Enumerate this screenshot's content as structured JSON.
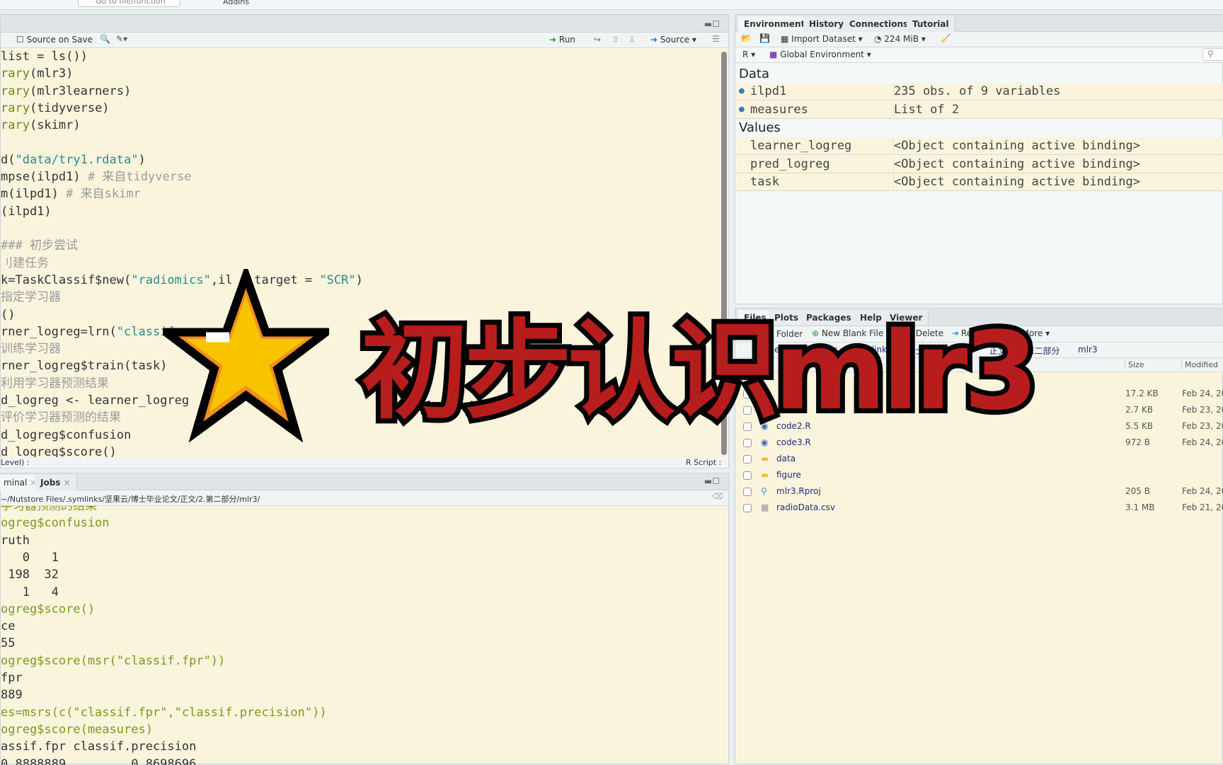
{
  "topbar": {
    "goto_placeholder": "Go to file/function",
    "addins": "Addins"
  },
  "editor": {
    "source_on_save": "Source on Save",
    "run": "Run",
    "source": "Source",
    "lines": [
      [
        [
          "list = ls())",
          ""
        ]
      ],
      [
        [
          "rary",
          "fn"
        ],
        [
          "(mlr3)",
          ""
        ]
      ],
      [
        [
          "rary",
          "fn"
        ],
        [
          "(mlr3learners)",
          ""
        ]
      ],
      [
        [
          "rary",
          "fn"
        ],
        [
          "(tidyverse)",
          ""
        ]
      ],
      [
        [
          "rary",
          "fn"
        ],
        [
          "(skimr)",
          ""
        ]
      ],
      [],
      [
        [
          "d(",
          ""
        ],
        [
          "\"data/try1.rdata\"",
          "str"
        ],
        [
          ")",
          ""
        ]
      ],
      [
        [
          "mpse(ilpd1) ",
          ""
        ],
        [
          "# 来自tidyverse",
          "cm"
        ]
      ],
      [
        [
          "m(ilpd1) ",
          ""
        ],
        [
          "# 来自skimr",
          "cm"
        ]
      ],
      [
        [
          "(ilpd1)",
          ""
        ]
      ],
      [],
      [
        [
          "### 初步尝试",
          "cm"
        ]
      ],
      [
        [
          "刂建任务",
          "cm"
        ]
      ],
      [
        [
          "k=TaskClassif$new(",
          ""
        ],
        [
          "\"radiomics\"",
          "str"
        ],
        [
          ",il",
          ""
        ],
        [
          "  ,target = ",
          ""
        ],
        [
          "\"SCR\"",
          "str"
        ],
        [
          ")",
          ""
        ]
      ],
      [
        [
          "指定学习器",
          "cm"
        ]
      ],
      [
        [
          "()",
          ""
        ]
      ],
      [
        [
          "rner_logreg=lrn(",
          ""
        ],
        [
          "\"classif",
          "str"
        ]
      ],
      [
        [
          "训练学习器",
          "cm"
        ]
      ],
      [
        [
          "rner_logreg$train(task)",
          ""
        ]
      ],
      [
        [
          "利用学习器预测结果",
          "cm"
        ]
      ],
      [
        [
          "d_logreg <- learner_logreg",
          ""
        ]
      ],
      [
        [
          "评价学习器预测的结果",
          "cm"
        ]
      ],
      [
        [
          "d_logreg$confusion",
          ""
        ]
      ],
      [
        [
          "d_logreg$score()",
          ""
        ]
      ]
    ],
    "status_left": "Level) :",
    "status_right": "R Script :"
  },
  "console": {
    "tabs": [
      "minal",
      "Jobs"
    ],
    "path": "~/Nutstore Files/.symlinks/坚果云/博士毕业论文/正文/2.第二部分/mlr3/",
    "lines": [
      [
        [
          "学习器预测的结果",
          "cmd"
        ]
      ],
      [
        [
          "ogreg$confusion",
          "cmd"
        ]
      ],
      [
        [
          "ruth",
          ""
        ]
      ],
      [
        [
          "   0   1",
          ""
        ]
      ],
      [
        [
          " 198  32",
          ""
        ]
      ],
      [
        [
          "   1   4",
          ""
        ]
      ],
      [
        [
          "ogreg$score()",
          "cmd"
        ]
      ],
      [
        [
          "ce",
          ""
        ]
      ],
      [
        [
          "55",
          ""
        ]
      ],
      [
        [
          "ogreg$score(msr(\"classif.fpr\"))",
          "cmd"
        ]
      ],
      [
        [
          "fpr",
          ""
        ]
      ],
      [
        [
          "889",
          ""
        ]
      ],
      [
        [
          "es=msrs(c(\"classif.fpr\",\"classif.precision\"))",
          "cmd"
        ]
      ],
      [
        [
          "ogreg$score(measures)",
          "cmd"
        ]
      ],
      [
        [
          "assif.fpr classif.precision",
          ""
        ]
      ],
      [
        [
          "0.8888889         0.8698696",
          ""
        ]
      ]
    ]
  },
  "environment": {
    "tabs": [
      "Environment",
      "History",
      "Connections",
      "Tutorial"
    ],
    "import_dataset": "Import Dataset",
    "memory": "224 MiB",
    "lang": "R",
    "scope": "Global Environment",
    "data_heading": "Data",
    "values_heading": "Values",
    "data": [
      {
        "name": "ilpd1",
        "value": "235 obs. of 9 variables"
      },
      {
        "name": "measures",
        "value": "List of  2"
      }
    ],
    "values": [
      {
        "name": "learner_logreg",
        "value": "<Object containing active binding>"
      },
      {
        "name": "pred_logreg",
        "value": "<Object containing active binding>"
      },
      {
        "name": "task",
        "value": "<Object containing active binding>"
      }
    ]
  },
  "files": {
    "tabs": [
      "Files",
      "Plots",
      "Packages",
      "Help",
      "Viewer"
    ],
    "new_folder": "New Folder",
    "new_blank_file": "New Blank File",
    "delete": "Delete",
    "rename": "Rename",
    "more": "More",
    "breadcrumb": [
      "ome",
      "Nutstor",
      ".symlinks",
      "士毕业论文",
      "正文",
      "2.第二部分",
      "mlr3"
    ],
    "col_size": "Size",
    "col_modified": "Modified",
    "rows": [
      {
        "name": "",
        "size": "17.2 KB",
        "modified": "Feb 24, 20",
        "type": "r"
      },
      {
        "name": "",
        "size": "2.7 KB",
        "modified": "Feb 23, 20",
        "type": "r"
      },
      {
        "name": "code2.R",
        "size": "5.5 KB",
        "modified": "Feb 23, 20",
        "type": "r"
      },
      {
        "name": "code3.R",
        "size": "972 B",
        "modified": "Feb 24, 20",
        "type": "r"
      },
      {
        "name": "data",
        "size": "",
        "modified": "",
        "type": "folder"
      },
      {
        "name": "figure",
        "size": "",
        "modified": "",
        "type": "folder"
      },
      {
        "name": "mlr3.Rproj",
        "size": "205 B",
        "modified": "Feb 24, 20",
        "type": "rproj"
      },
      {
        "name": "radioData.csv",
        "size": "3.1 MB",
        "modified": "Feb 21, 20",
        "type": "csv"
      }
    ]
  },
  "overlay": {
    "title": "初步认识mlr3"
  },
  "colors": {
    "title_red": "#b81d1d",
    "star_yellow": "#f8c400",
    "star_orange": "#f0901c",
    "editor_bg": "#fbf4dd"
  }
}
